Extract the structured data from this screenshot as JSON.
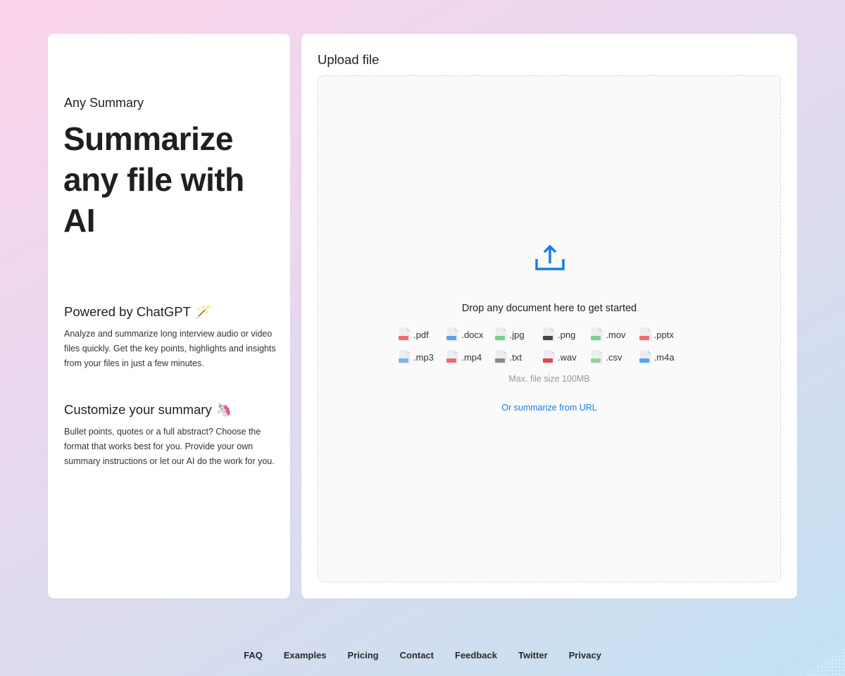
{
  "left": {
    "brand": "Any Summary",
    "headline": "Summarize any file with AI",
    "features": [
      {
        "title": "Powered by ChatGPT",
        "emoji": "🪄",
        "body": "Analyze and summarize long interview audio or video files quickly. Get the key points, highlights and insights from your files in just a few minutes."
      },
      {
        "title": "Customize your summary",
        "emoji": "🦄",
        "body": "Bullet points, quotes or a full abstract? Choose the format that works best for you. Provide your own summary instructions or let our AI do the work for you."
      }
    ]
  },
  "upload": {
    "title": "Upload file",
    "drop_text": "Drop any document here to get started",
    "icon": "upload-icon",
    "file_types": [
      {
        "label": ".pdf",
        "icon": "pdf-file-icon",
        "color": "#f26b6b"
      },
      {
        "label": ".docx",
        "icon": "docx-file-icon",
        "color": "#5aa2ee"
      },
      {
        "label": ".jpg",
        "icon": "jpg-file-icon",
        "color": "#7ccf8c"
      },
      {
        "label": ".png",
        "icon": "png-file-icon",
        "color": "#444444"
      },
      {
        "label": ".mov",
        "icon": "mov-file-icon",
        "color": "#7ccf8c"
      },
      {
        "label": ".pptx",
        "icon": "pptx-file-icon",
        "color": "#f26b6b"
      },
      {
        "label": ".mp3",
        "icon": "mp3-file-icon",
        "color": "#7fb3ee"
      },
      {
        "label": ".mp4",
        "icon": "mp4-file-icon",
        "color": "#f26b6b"
      },
      {
        "label": ".txt",
        "icon": "txt-file-icon",
        "color": "#8a8a8a"
      },
      {
        "label": ".wav",
        "icon": "wav-file-icon",
        "color": "#e24848"
      },
      {
        "label": ".csv",
        "icon": "csv-file-icon",
        "color": "#8fd49d"
      },
      {
        "label": ".m4a",
        "icon": "m4a-file-icon",
        "color": "#5aa2ee"
      }
    ],
    "max_size": "Max. file size 100MB",
    "url_link": "Or summarize from URL",
    "accent_color": "#1a7be8"
  },
  "footer": {
    "links": [
      "FAQ",
      "Examples",
      "Pricing",
      "Contact",
      "Feedback",
      "Twitter",
      "Privacy"
    ]
  }
}
